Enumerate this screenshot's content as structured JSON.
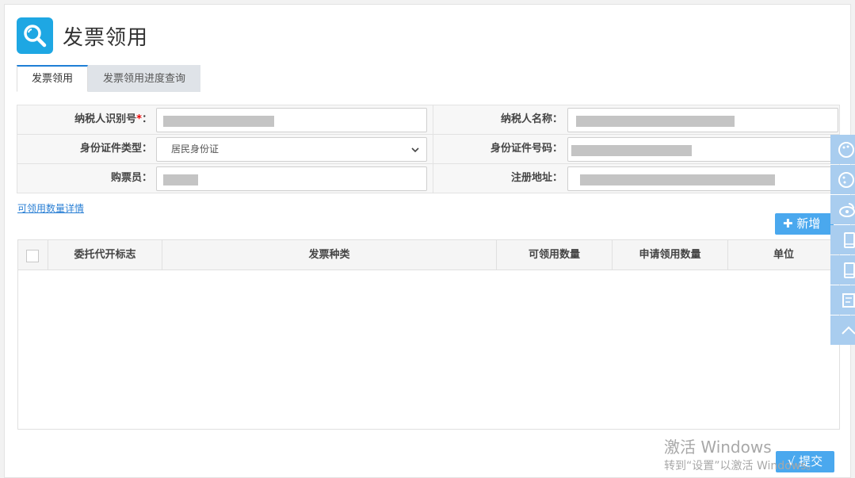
{
  "header": {
    "title": "发票领用"
  },
  "tabs": [
    {
      "label": "发票领用"
    },
    {
      "label": "发票领用进度查询"
    }
  ],
  "form": {
    "taxpayer_id_label": "纳税人识别号",
    "required_mark": "*",
    "colon": "：",
    "taxpayer_name_label": "纳税人名称：",
    "id_type_label": "身份证件类型：",
    "id_type_value": "居民身份证",
    "id_number_label": "身份证件号码：",
    "buyer_label": "购票员：",
    "address_label": "注册地址："
  },
  "links": {
    "detail": "可领用数量详情"
  },
  "buttons": {
    "add": "✚ 新增",
    "submit": "√ 提交"
  },
  "table": {
    "columns": [
      "委托代开标志",
      "发票种类",
      "可领用数量",
      "申请领用数量",
      "单位"
    ]
  },
  "watermark": {
    "line1": "激活 Windows",
    "line2": "转到“设置”以激活 Windows。"
  },
  "colors": {
    "accent": "#1ea7e3",
    "button": "#4aa8ee",
    "link": "#2a7fd4"
  }
}
